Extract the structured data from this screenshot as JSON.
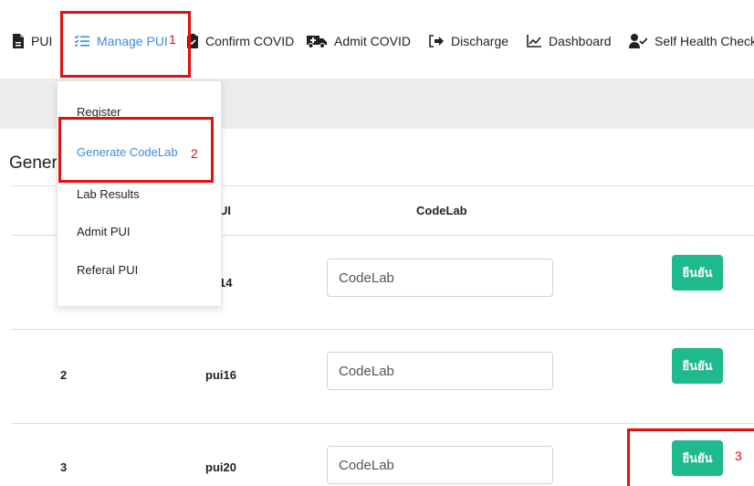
{
  "nav": {
    "items": [
      {
        "label": "PUI",
        "icon": "document-icon"
      },
      {
        "label": "Manage PUI",
        "icon": "checklist-icon"
      },
      {
        "label": "Confirm COVID",
        "icon": "clipboard-check-icon"
      },
      {
        "label": "Admit COVID",
        "icon": "ambulance-icon"
      },
      {
        "label": "Discharge",
        "icon": "sign-out-icon"
      },
      {
        "label": "Dashboard",
        "icon": "chart-line-icon"
      },
      {
        "label": "Self Health Check",
        "icon": "user-check-icon"
      }
    ],
    "active_color": "#3d8bd9"
  },
  "dropdown": {
    "items": [
      {
        "label": "Register"
      },
      {
        "label": "Generate CodeLab"
      },
      {
        "label": "Lab Results"
      },
      {
        "label": "Admit PUI"
      },
      {
        "label": "Referal PUI"
      }
    ]
  },
  "section_title": "Genera",
  "table": {
    "headers": {
      "pui": "UI",
      "codelab": "CodeLab"
    },
    "rows": [
      {
        "no": "",
        "pui": "14",
        "codelab_placeholder": "CodeLab",
        "button": "ยืนยัน"
      },
      {
        "no": "2",
        "pui": "pui16",
        "codelab_placeholder": "CodeLab",
        "button": "ยืนยัน"
      },
      {
        "no": "3",
        "pui": "pui20",
        "codelab_placeholder": "CodeLab",
        "button": "ยืนยัน"
      }
    ]
  },
  "annotations": [
    "1",
    "2",
    "3"
  ],
  "colors": {
    "confirm_button": "#1fb98e",
    "annotation": "#e01010",
    "band": "#ececec"
  }
}
